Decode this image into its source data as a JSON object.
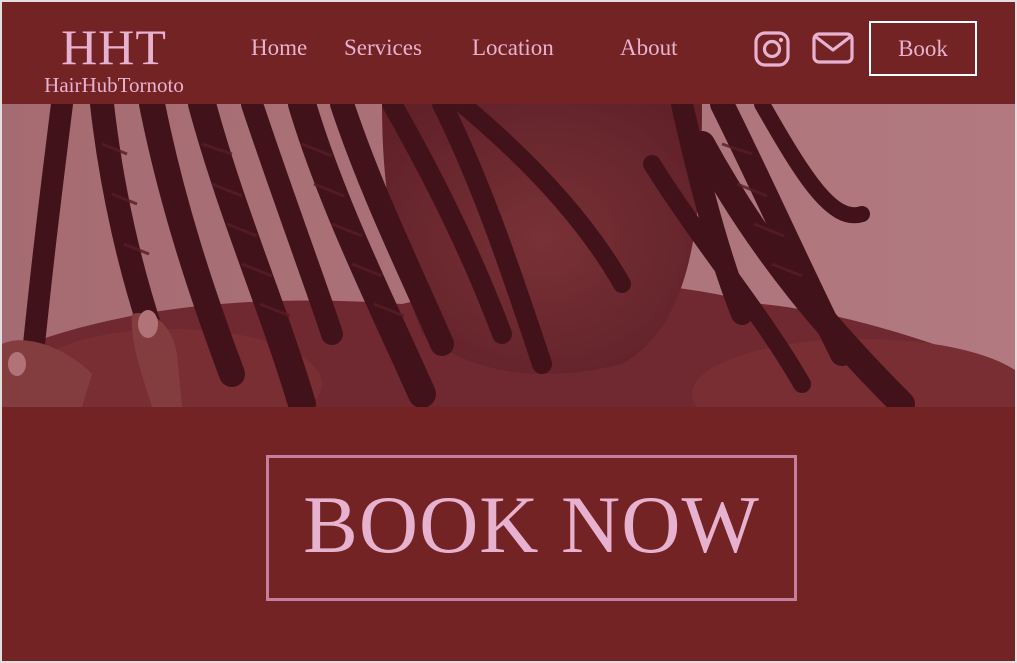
{
  "brand": {
    "mark": "HHT",
    "name": "HairHubTornoto"
  },
  "nav": {
    "items": [
      {
        "label": "Home"
      },
      {
        "label": "Services"
      },
      {
        "label": "Location"
      },
      {
        "label": "About"
      }
    ],
    "icons": [
      "instagram-icon",
      "mail-icon"
    ],
    "book_label": "Book"
  },
  "hero": {
    "image": "woman-with-box-braids"
  },
  "cta": {
    "label": "BOOK NOW"
  },
  "colors": {
    "primary": "#742325",
    "accent": "#e7b2cf",
    "cta_border": "#c77d9d",
    "hero_background": "#b98c8e"
  }
}
